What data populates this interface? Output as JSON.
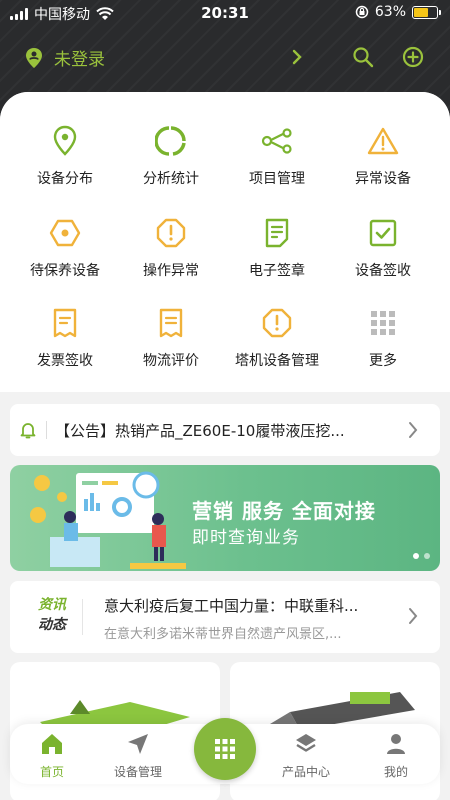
{
  "status_bar": {
    "carrier": "中国移动",
    "time": "20:31",
    "battery_text": "63%",
    "battery_level": 0.63
  },
  "header": {
    "login_text": "未登录"
  },
  "grid": [
    {
      "label": "设备分布",
      "icon": "location-pin-icon"
    },
    {
      "label": "分析统计",
      "icon": "pie-chart-icon"
    },
    {
      "label": "项目管理",
      "icon": "share-nodes-icon"
    },
    {
      "label": "异常设备",
      "icon": "warning-triangle-icon"
    },
    {
      "label": "待保养设备",
      "icon": "hexagon-dot-icon"
    },
    {
      "label": "操作异常",
      "icon": "octagon-alert-icon"
    },
    {
      "label": "电子签章",
      "icon": "document-icon"
    },
    {
      "label": "设备签收",
      "icon": "checkbox-icon"
    },
    {
      "label": "发票签收",
      "icon": "invoice-icon"
    },
    {
      "label": "物流评价",
      "icon": "receipt-icon"
    },
    {
      "label": "塔机设备管理",
      "icon": "octagon-alert-icon"
    },
    {
      "label": "更多",
      "icon": "more-grid-icon"
    }
  ],
  "notice": {
    "text": "【公告】热销产品_ZE60E-10履带液压挖..."
  },
  "banner": {
    "line1": "营销  服务  全面对接",
    "line2": "即时查询业务"
  },
  "news": {
    "tag_top": "资讯",
    "tag_bottom": "动态",
    "title": "意大利疫后复工中国力量：中联重科...",
    "subtitle": "在意大利多诺米蒂世界自然遗产风景区,..."
  },
  "tabs": [
    {
      "label": "首页",
      "icon": "home-icon"
    },
    {
      "label": "设备管理",
      "icon": "navigation-arrow-icon"
    },
    {
      "label": "产品中心",
      "icon": "layers-icon"
    },
    {
      "label": "我的",
      "icon": "user-icon"
    }
  ],
  "colors": {
    "accent_green": "#7ab32e",
    "warning_orange": "#f0b23a",
    "header_dark": "#2a2b2d"
  }
}
